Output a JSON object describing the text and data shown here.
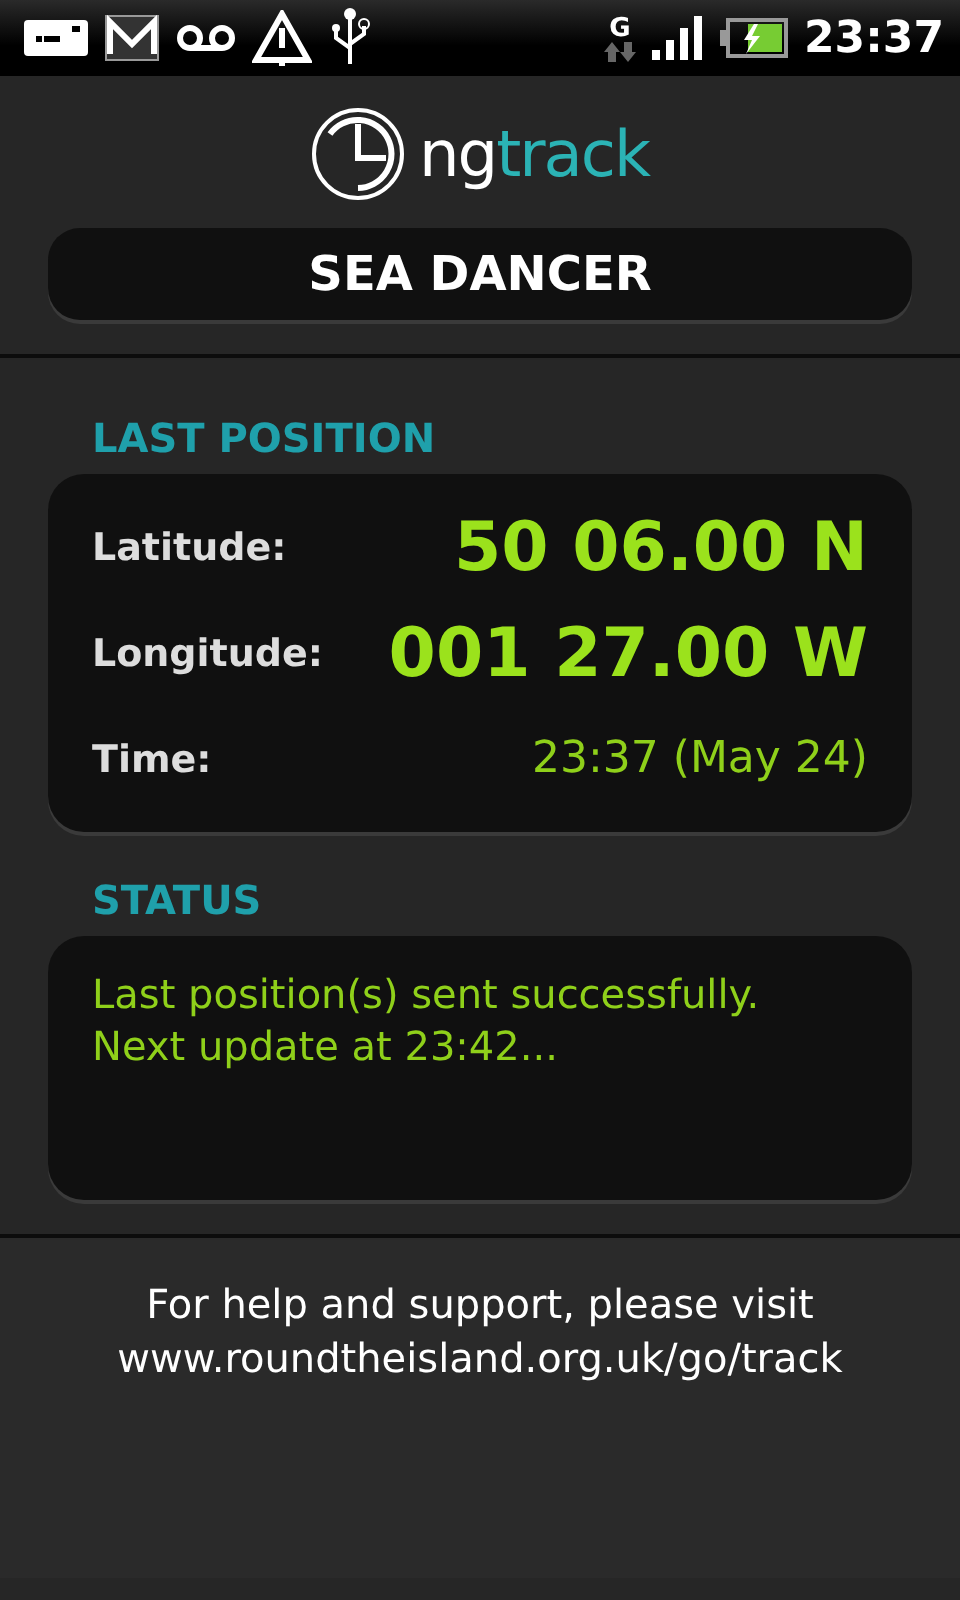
{
  "status_bar": {
    "network": "G",
    "time": "23:37"
  },
  "logo": {
    "prefix": "ng",
    "suffix": "track"
  },
  "vessel": {
    "name": "SEA DANCER"
  },
  "last_position": {
    "title": "LAST POSITION",
    "rows": [
      {
        "label": "Latitude:",
        "value": "50 06.00 N",
        "kind": "large"
      },
      {
        "label": "Longitude:",
        "value": "001 27.00 W",
        "kind": "large"
      },
      {
        "label": "Time:",
        "value": "23:37 (May 24)",
        "kind": "small"
      }
    ]
  },
  "status": {
    "title": "STATUS",
    "lines": [
      "Last position(s) sent successfully.",
      "Next update at 23:42..."
    ]
  },
  "footer": {
    "lines": [
      "For help and support, please visit",
      "www.roundtheisland.org.uk/go/track"
    ]
  }
}
